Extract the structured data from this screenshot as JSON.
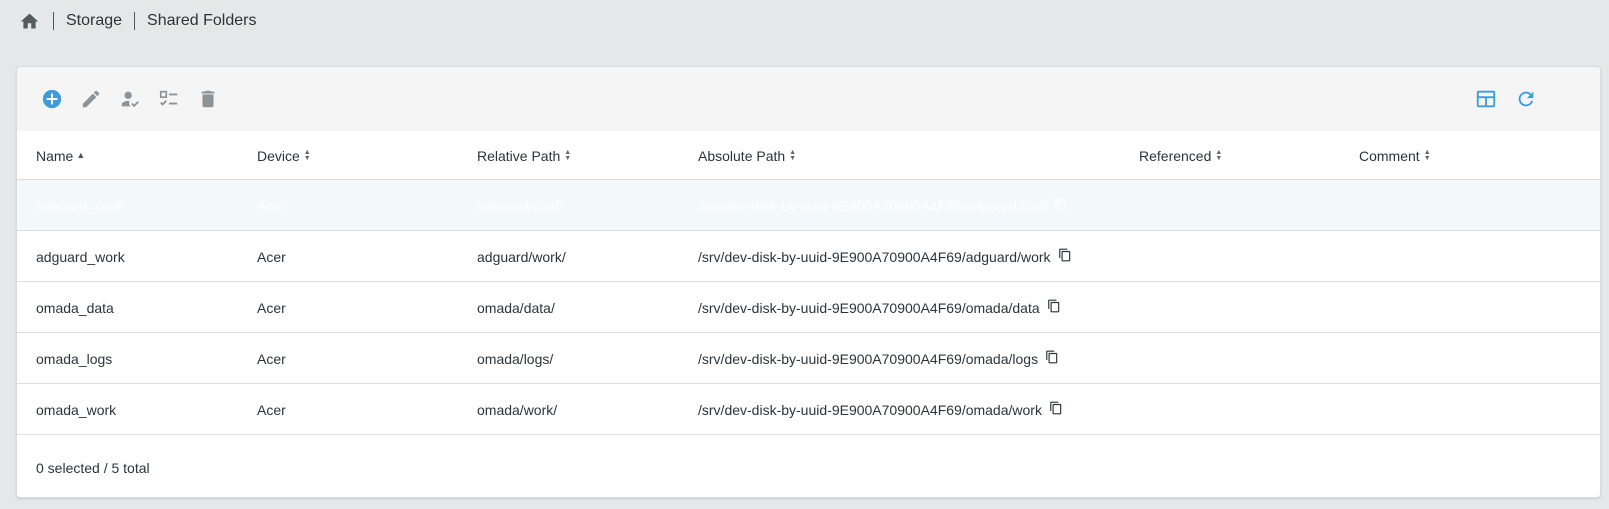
{
  "breadcrumb": {
    "home_icon": "home-icon",
    "items": [
      "Storage",
      "Shared Folders"
    ]
  },
  "toolbar": {
    "left_buttons": [
      "add-circle-icon",
      "edit-pencil-icon",
      "user-permissions-icon",
      "acl-list-icon",
      "delete-trash-icon"
    ],
    "right_buttons": [
      "table-columns-icon",
      "refresh-icon"
    ],
    "accent_color": "#3d9ddb",
    "disabled_color": "#8e9397"
  },
  "table": {
    "columns": [
      {
        "label": "Name",
        "sort": "asc"
      },
      {
        "label": "Device",
        "sort": "none"
      },
      {
        "label": "Relative Path",
        "sort": "none"
      },
      {
        "label": "Absolute Path",
        "sort": "none"
      },
      {
        "label": "Referenced",
        "sort": "none"
      },
      {
        "label": "Comment",
        "sort": "none"
      }
    ],
    "rows": [
      {
        "name": "adguard_conf",
        "device": "Acer",
        "relative_path": "adguard/conf/",
        "absolute_path": "/srv/dev-disk-by-uuid-9E900A70900A4F69/adguard/conf",
        "referenced": "",
        "comment": ""
      },
      {
        "name": "adguard_work",
        "device": "Acer",
        "relative_path": "adguard/work/",
        "absolute_path": "/srv/dev-disk-by-uuid-9E900A70900A4F69/adguard/work",
        "referenced": "",
        "comment": ""
      },
      {
        "name": "omada_data",
        "device": "Acer",
        "relative_path": "omada/data/",
        "absolute_path": "/srv/dev-disk-by-uuid-9E900A70900A4F69/omada/data",
        "referenced": "",
        "comment": ""
      },
      {
        "name": "omada_logs",
        "device": "Acer",
        "relative_path": "omada/logs/",
        "absolute_path": "/srv/dev-disk-by-uuid-9E900A70900A4F69/omada/logs",
        "referenced": "",
        "comment": ""
      },
      {
        "name": "omada_work",
        "device": "Acer",
        "relative_path": "omada/work/",
        "absolute_path": "/srv/dev-disk-by-uuid-9E900A70900A4F69/omada/work",
        "referenced": "",
        "comment": ""
      }
    ],
    "copy_icon": "copy-clipboard-icon"
  },
  "footer": {
    "summary": "0 selected / 5 total"
  }
}
